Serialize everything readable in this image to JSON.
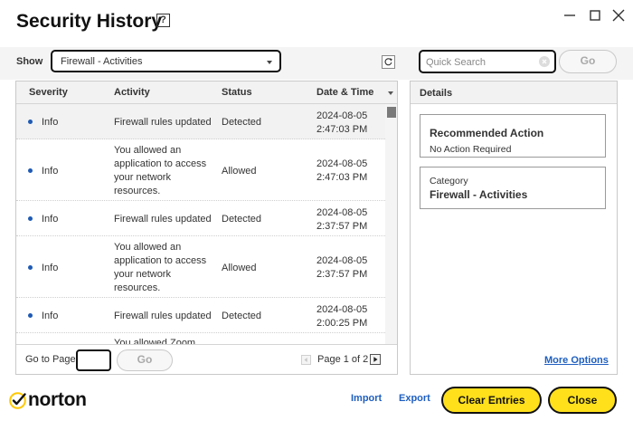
{
  "window": {
    "title": "Security History",
    "help_symbol": "?"
  },
  "toolbar": {
    "show_label": "Show",
    "filter_selected": "Firewall - Activities",
    "search_placeholder": "Quick Search",
    "go_label": "Go"
  },
  "table": {
    "headers": {
      "severity": "Severity",
      "activity": "Activity",
      "status": "Status",
      "datetime": "Date & Time"
    },
    "rows": [
      {
        "severity": "Info",
        "activity": [
          "Firewall rules updated"
        ],
        "status": "Detected",
        "date": "2024-08-05",
        "time": "2:47:03 PM"
      },
      {
        "severity": "Info",
        "activity": [
          "You allowed an",
          "application to access",
          "your network",
          "resources."
        ],
        "status": "Allowed",
        "date": "2024-08-05",
        "time": "2:47:03 PM"
      },
      {
        "severity": "Info",
        "activity": [
          "Firewall rules updated"
        ],
        "status": "Detected",
        "date": "2024-08-05",
        "time": "2:37:57 PM"
      },
      {
        "severity": "Info",
        "activity": [
          "You allowed an",
          "application to access",
          "your network",
          "resources."
        ],
        "status": "Allowed",
        "date": "2024-08-05",
        "time": "2:37:57 PM"
      },
      {
        "severity": "Info",
        "activity": [
          "Firewall rules updated"
        ],
        "status": "Detected",
        "date": "2024-08-05",
        "time": "2:00:25 PM"
      },
      {
        "severity": "",
        "activity": [
          "You allowed Zoom"
        ],
        "status": "",
        "date": "",
        "time": ""
      }
    ],
    "footer": {
      "goto_label": "Go to Page:",
      "page_value": "",
      "go_label": "Go",
      "page_info": "Page 1 of 2"
    }
  },
  "details": {
    "title": "Details",
    "recommended_title": "Recommended Action",
    "recommended_value": "No Action Required",
    "category_label": "Category",
    "category_value": "Firewall - Activities",
    "more_options": "More Options"
  },
  "footer": {
    "brand": "norton",
    "import_label": "Import",
    "export_label": "Export",
    "clear_label": "Clear Entries",
    "close_label": "Close"
  },
  "colors": {
    "accent_yellow": "#ffe01b",
    "link_blue": "#1f5fbf",
    "info_dot": "#1e5ab4"
  }
}
